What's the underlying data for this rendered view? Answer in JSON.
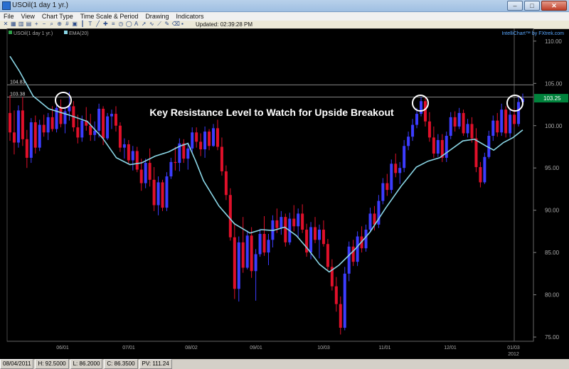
{
  "window": {
    "title": "USOil(1 day  1 yr.)"
  },
  "menu": [
    "File",
    "View",
    "Chart Type",
    "Time Scale & Period",
    "Drawing",
    "Indicators"
  ],
  "toolbar": {
    "icons": [
      "crosshair-icon",
      "tile-icon",
      "chart-type-icon",
      "period-icon",
      "zoom-in-icon",
      "zoom-out-icon",
      "search-icon",
      "magnify-icon",
      "grid-icon",
      "print-icon",
      "bar-icon",
      "text-icon",
      "line-icon",
      "cross-icon",
      "fib-icon",
      "cycle-icon",
      "ellipse-icon",
      "letter-a-icon",
      "arrow-icon",
      "wave-icon",
      "trend-icon",
      "pencil-icon",
      "erase-icon",
      "save-icon"
    ],
    "updated": "Updated: 02:39:28 PM"
  },
  "brand": "IntelliChart™ by FXtrek.com",
  "status": {
    "date": "08/04/2011",
    "high": "H: 92.5000",
    "low": "L: 86.2000",
    "close": "C: 86.3500",
    "pv": "PV: 111.24"
  },
  "colors": {
    "up": "#3c3cff",
    "down": "#e0102a",
    "ema": "#8ad6e6",
    "price_box": "#00823c",
    "bg": "#000000"
  },
  "chart_data": {
    "type": "candlestick",
    "legend": [
      {
        "label": "USOil(1 day  1 yr.)",
        "color": "#2fa04a"
      },
      {
        "label": "EMA(20)",
        "color": "#8ad6e6"
      }
    ],
    "annotation": "Key Resistance Level to Watch for Upside Breakout",
    "xlabels": [
      "06/01",
      "07/01",
      "08/02",
      "09/01",
      "10/03",
      "11/01",
      "12/01",
      "01/03"
    ],
    "xlabel_sub": "2012",
    "yticks": [
      75.0,
      80.0,
      85.0,
      90.0,
      95.0,
      100.0,
      105.0,
      110.0
    ],
    "ylim": [
      74.5,
      111.5
    ],
    "resistance_lines": [
      104.83,
      103.38
    ],
    "resistance_labels": [
      "104.83",
      "103.38"
    ],
    "last_price": "103.25",
    "highlight_circles": [
      "late April 2011",
      "mid November 2011",
      "early January 2012"
    ],
    "ema20": [
      {
        "t": 0,
        "v": 108.2
      },
      {
        "t": 5,
        "v": 106.4
      },
      {
        "t": 12,
        "v": 103.5
      },
      {
        "t": 20,
        "v": 102.0
      },
      {
        "t": 30,
        "v": 101.3
      },
      {
        "t": 40,
        "v": 100.5
      },
      {
        "t": 48,
        "v": 98.5
      },
      {
        "t": 55,
        "v": 96.2
      },
      {
        "t": 62,
        "v": 95.4
      },
      {
        "t": 68,
        "v": 95.6
      },
      {
        "t": 75,
        "v": 96.4
      },
      {
        "t": 82,
        "v": 96.9
      },
      {
        "t": 88,
        "v": 97.6
      },
      {
        "t": 92,
        "v": 97.9
      },
      {
        "t": 96,
        "v": 95.8
      },
      {
        "t": 100,
        "v": 93.5
      },
      {
        "t": 108,
        "v": 90.5
      },
      {
        "t": 116,
        "v": 88.4
      },
      {
        "t": 124,
        "v": 87.3
      },
      {
        "t": 130,
        "v": 87.7
      },
      {
        "t": 136,
        "v": 87.6
      },
      {
        "t": 142,
        "v": 88.0
      },
      {
        "t": 148,
        "v": 87.0
      },
      {
        "t": 154,
        "v": 85.4
      },
      {
        "t": 160,
        "v": 83.6
      },
      {
        "t": 165,
        "v": 82.7
      },
      {
        "t": 170,
        "v": 83.5
      },
      {
        "t": 178,
        "v": 85.3
      },
      {
        "t": 186,
        "v": 87.4
      },
      {
        "t": 194,
        "v": 90.2
      },
      {
        "t": 202,
        "v": 92.8
      },
      {
        "t": 210,
        "v": 95.1
      },
      {
        "t": 216,
        "v": 95.8
      },
      {
        "t": 222,
        "v": 96.2
      },
      {
        "t": 228,
        "v": 97.2
      },
      {
        "t": 234,
        "v": 98.2
      },
      {
        "t": 240,
        "v": 98.4
      },
      {
        "t": 246,
        "v": 97.6
      },
      {
        "t": 250,
        "v": 97.1
      },
      {
        "t": 255,
        "v": 98.0
      },
      {
        "t": 260,
        "v": 98.6
      },
      {
        "t": 265,
        "v": 99.5
      }
    ],
    "candles": [
      [
        0,
        101.5,
        103.6,
        98.2,
        99.2
      ],
      [
        1,
        99.2,
        101.8,
        96.6,
        98.0
      ],
      [
        2,
        98.0,
        102.4,
        97.4,
        101.8
      ],
      [
        3,
        101.8,
        103.4,
        97.6,
        98.4
      ],
      [
        4,
        98.4,
        99.5,
        95.0,
        96.2
      ],
      [
        5,
        96.2,
        100.9,
        95.6,
        100.4
      ],
      [
        6,
        100.4,
        101.2,
        96.7,
        97.4
      ],
      [
        7,
        97.4,
        100.7,
        97.0,
        100.1
      ],
      [
        8,
        100.1,
        101.3,
        98.7,
        99.2
      ],
      [
        9,
        99.2,
        101.5,
        98.3,
        101.0
      ],
      [
        10,
        101.0,
        102.3,
        99.3,
        99.6
      ],
      [
        11,
        99.6,
        102.6,
        99.2,
        102.1
      ],
      [
        12,
        102.1,
        103.1,
        99.8,
        100.2
      ],
      [
        13,
        100.2,
        102.2,
        99.1,
        101.7
      ],
      [
        14,
        101.7,
        104.0,
        100.6,
        102.3
      ],
      [
        15,
        102.3,
        102.9,
        99.3,
        99.8
      ],
      [
        16,
        99.8,
        101.3,
        97.9,
        98.6
      ],
      [
        17,
        98.6,
        101.2,
        98.1,
        100.6
      ],
      [
        18,
        100.6,
        102.2,
        99.4,
        100.0
      ],
      [
        19,
        100.0,
        101.4,
        98.2,
        98.9
      ],
      [
        20,
        98.9,
        100.5,
        98.2,
        99.4
      ],
      [
        21,
        99.4,
        102.6,
        98.6,
        102.0
      ],
      [
        22,
        102.0,
        102.3,
        97.7,
        98.5
      ],
      [
        23,
        98.5,
        101.5,
        98.3,
        101.1
      ],
      [
        24,
        101.1,
        101.9,
        99.6,
        101.4
      ],
      [
        25,
        101.4,
        102.3,
        99.3,
        100.0
      ],
      [
        26,
        100.0,
        100.4,
        96.9,
        97.4
      ],
      [
        27,
        97.4,
        98.5,
        96.1,
        97.8
      ],
      [
        28,
        97.8,
        98.3,
        95.4,
        95.9
      ],
      [
        29,
        95.9,
        97.6,
        94.7,
        97.0
      ],
      [
        30,
        97.0,
        97.5,
        94.5,
        94.8
      ],
      [
        31,
        94.8,
        96.1,
        92.3,
        93.2
      ],
      [
        32,
        93.2,
        96.1,
        92.6,
        95.6
      ],
      [
        33,
        95.6,
        97.3,
        92.8,
        93.6
      ],
      [
        34,
        93.6,
        95.1,
        89.9,
        90.6
      ],
      [
        35,
        90.6,
        94.0,
        89.4,
        93.3
      ],
      [
        36,
        93.3,
        93.6,
        89.9,
        90.3
      ],
      [
        37,
        90.3,
        94.5,
        89.9,
        94.0
      ],
      [
        38,
        94.0,
        96.2,
        93.7,
        95.7
      ],
      [
        39,
        95.7,
        97.5,
        94.7,
        95.6
      ],
      [
        40,
        95.6,
        98.5,
        94.6,
        97.9
      ],
      [
        41,
        97.9,
        98.4,
        95.6,
        96.1
      ],
      [
        42,
        96.1,
        98.0,
        94.8,
        97.3
      ],
      [
        43,
        97.3,
        99.8,
        96.8,
        99.2
      ],
      [
        44,
        99.2,
        99.8,
        97.4,
        98.1
      ],
      [
        45,
        98.1,
        99.1,
        96.4,
        97.2
      ],
      [
        46,
        97.2,
        99.9,
        96.2,
        99.3
      ],
      [
        47,
        99.3,
        99.6,
        97.1,
        97.6
      ],
      [
        48,
        97.6,
        100.2,
        97.5,
        99.7
      ],
      [
        49,
        99.7,
        100.7,
        97.1,
        97.5
      ],
      [
        50,
        97.5,
        98.6,
        94.1,
        94.6
      ],
      [
        51,
        94.6,
        95.3,
        91.2,
        91.8
      ],
      [
        52,
        91.8,
        92.6,
        86.4,
        86.8
      ],
      [
        53,
        86.8,
        88.4,
        79.5,
        80.7
      ],
      [
        54,
        80.7,
        86.9,
        79.2,
        86.2
      ],
      [
        55,
        86.2,
        89.2,
        82.6,
        83.2
      ],
      [
        56,
        83.2,
        87.6,
        83.0,
        87.0
      ],
      [
        57,
        87.0,
        88.0,
        82.0,
        82.8
      ],
      [
        58,
        82.8,
        85.4,
        79.3,
        84.8
      ],
      [
        59,
        84.8,
        87.8,
        84.5,
        87.2
      ],
      [
        60,
        87.2,
        89.3,
        84.6,
        85.0
      ],
      [
        61,
        85.0,
        87.2,
        83.5,
        86.5
      ],
      [
        62,
        86.5,
        89.4,
        85.6,
        88.8
      ],
      [
        63,
        88.8,
        90.2,
        87.3,
        87.9
      ],
      [
        64,
        87.9,
        89.9,
        87.1,
        89.2
      ],
      [
        65,
        89.2,
        89.6,
        85.7,
        86.2
      ],
      [
        66,
        86.2,
        89.7,
        85.9,
        89.0
      ],
      [
        67,
        89.0,
        90.6,
        87.5,
        88.1
      ],
      [
        68,
        88.1,
        90.2,
        86.8,
        89.6
      ],
      [
        69,
        89.6,
        90.7,
        87.3,
        87.7
      ],
      [
        70,
        87.7,
        88.4,
        84.5,
        85.0
      ],
      [
        71,
        85.0,
        88.6,
        84.2,
        88.0
      ],
      [
        72,
        88.0,
        89.2,
        86.1,
        86.5
      ],
      [
        73,
        86.5,
        88.3,
        84.3,
        87.7
      ],
      [
        74,
        87.7,
        88.8,
        85.7,
        86.0
      ],
      [
        75,
        86.0,
        86.6,
        82.9,
        83.3
      ],
      [
        76,
        83.3,
        84.2,
        80.5,
        81.0
      ],
      [
        77,
        81.0,
        82.1,
        78.0,
        78.9
      ],
      [
        78,
        78.9,
        79.8,
        75.3,
        76.1
      ],
      [
        79,
        76.1,
        83.3,
        75.8,
        82.5
      ],
      [
        80,
        82.5,
        86.3,
        81.6,
        85.7
      ],
      [
        81,
        85.7,
        86.5,
        83.4,
        83.9
      ],
      [
        82,
        83.9,
        87.5,
        83.4,
        86.9
      ],
      [
        83,
        86.9,
        88.1,
        85.0,
        85.5
      ],
      [
        84,
        85.5,
        88.3,
        85.1,
        87.7
      ],
      [
        85,
        87.7,
        90.3,
        87.5,
        89.6
      ],
      [
        86,
        89.6,
        90.5,
        87.6,
        88.3
      ],
      [
        87,
        88.3,
        91.8,
        87.9,
        91.1
      ],
      [
        88,
        91.1,
        93.8,
        90.7,
        93.2
      ],
      [
        89,
        93.2,
        94.3,
        91.7,
        92.4
      ],
      [
        90,
        92.4,
        96.0,
        92.0,
        95.5
      ],
      [
        91,
        95.5,
        96.7,
        93.9,
        94.4
      ],
      [
        92,
        94.4,
        95.7,
        93.1,
        95.0
      ],
      [
        93,
        95.0,
        98.3,
        94.5,
        97.6
      ],
      [
        94,
        97.6,
        99.3,
        97.1,
        98.7
      ],
      [
        95,
        98.7,
        100.8,
        98.2,
        100.1
      ],
      [
        96,
        100.1,
        102.1,
        99.7,
        101.4
      ],
      [
        97,
        101.4,
        103.4,
        101.1,
        102.9
      ],
      [
        98,
        102.9,
        103.4,
        99.9,
        100.5
      ],
      [
        99,
        100.5,
        101.6,
        98.1,
        98.6
      ],
      [
        100,
        98.6,
        99.9,
        96.2,
        96.7
      ],
      [
        101,
        96.7,
        99.0,
        96.3,
        98.3
      ],
      [
        102,
        98.3,
        99.0,
        95.7,
        96.2
      ],
      [
        103,
        96.2,
        99.3,
        95.7,
        98.8
      ],
      [
        104,
        98.8,
        101.6,
        98.4,
        101.0
      ],
      [
        105,
        101.0,
        101.7,
        99.3,
        99.9
      ],
      [
        106,
        99.9,
        102.1,
        99.6,
        101.5
      ],
      [
        107,
        101.5,
        101.9,
        98.8,
        99.1
      ],
      [
        108,
        99.1,
        100.8,
        98.6,
        100.2
      ],
      [
        109,
        100.2,
        101.0,
        98.0,
        98.5
      ],
      [
        110,
        98.5,
        99.7,
        94.5,
        95.1
      ],
      [
        111,
        95.1,
        95.7,
        92.7,
        93.3
      ],
      [
        112,
        93.3,
        96.8,
        93.1,
        96.3
      ],
      [
        113,
        96.3,
        99.4,
        96.1,
        98.8
      ],
      [
        114,
        98.8,
        101.2,
        98.2,
        100.6
      ],
      [
        115,
        100.6,
        101.5,
        98.7,
        99.2
      ],
      [
        116,
        99.2,
        102.6,
        98.8,
        101.9
      ],
      [
        117,
        101.9,
        102.3,
        98.6,
        99.1
      ],
      [
        118,
        99.1,
        101.9,
        98.6,
        101.3
      ],
      [
        119,
        101.3,
        102.0,
        99.8,
        100.2
      ],
      [
        120,
        100.2,
        103.4,
        99.9,
        102.8
      ],
      [
        121,
        102.8,
        103.8,
        102.4,
        103.2
      ]
    ]
  }
}
